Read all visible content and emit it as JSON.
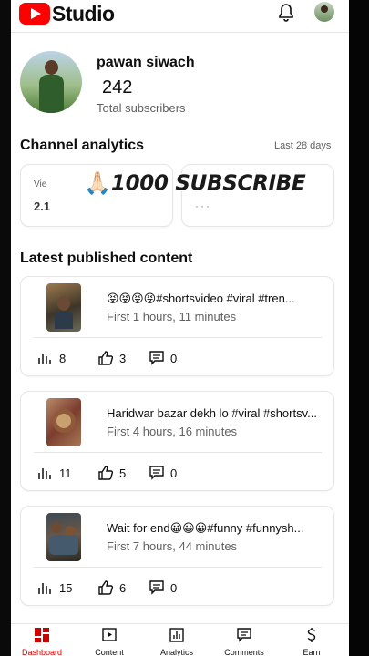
{
  "header": {
    "brand": "Studio"
  },
  "channel": {
    "name": "pawan siwach",
    "subscribers": "242",
    "subscribers_label": "Total subscribers"
  },
  "analytics": {
    "title": "Channel analytics",
    "period": "Last 28 days",
    "views_label": "Vie",
    "views_value": "2.1",
    "watch_value": "···"
  },
  "overlay": {
    "emoji": "🙏🏻",
    "text": "1000 SUBSCRIBE"
  },
  "content": {
    "title": "Latest published content",
    "videos": [
      {
        "title": "😝😝😝😝#shortsvideo #viral #tren...",
        "subtitle": "First 1 hours, 11 minutes",
        "views": "8",
        "likes": "3",
        "comments": "0"
      },
      {
        "title": "Haridwar bazar dekh lo #viral #shortsv...",
        "subtitle": "First 4 hours, 16 minutes",
        "views": "11",
        "likes": "5",
        "comments": "0"
      },
      {
        "title": "Wait for end😀😀😀#funny #funnysh...",
        "subtitle": "First 7 hours, 44 minutes",
        "views": "15",
        "likes": "6",
        "comments": "0"
      }
    ]
  },
  "nav": {
    "items": [
      {
        "label": "Dashboard",
        "icon": "dashboard-icon",
        "active": true
      },
      {
        "label": "Content",
        "icon": "content-icon"
      },
      {
        "label": "Analytics",
        "icon": "analytics-icon"
      },
      {
        "label": "Comments",
        "icon": "comments-icon"
      },
      {
        "label": "Earn",
        "icon": "earn-icon"
      }
    ]
  },
  "colors": {
    "brand_red": "#ff0000",
    "active_red": "#cc0000",
    "text": "#0f0f0f",
    "secondary": "#606060"
  }
}
